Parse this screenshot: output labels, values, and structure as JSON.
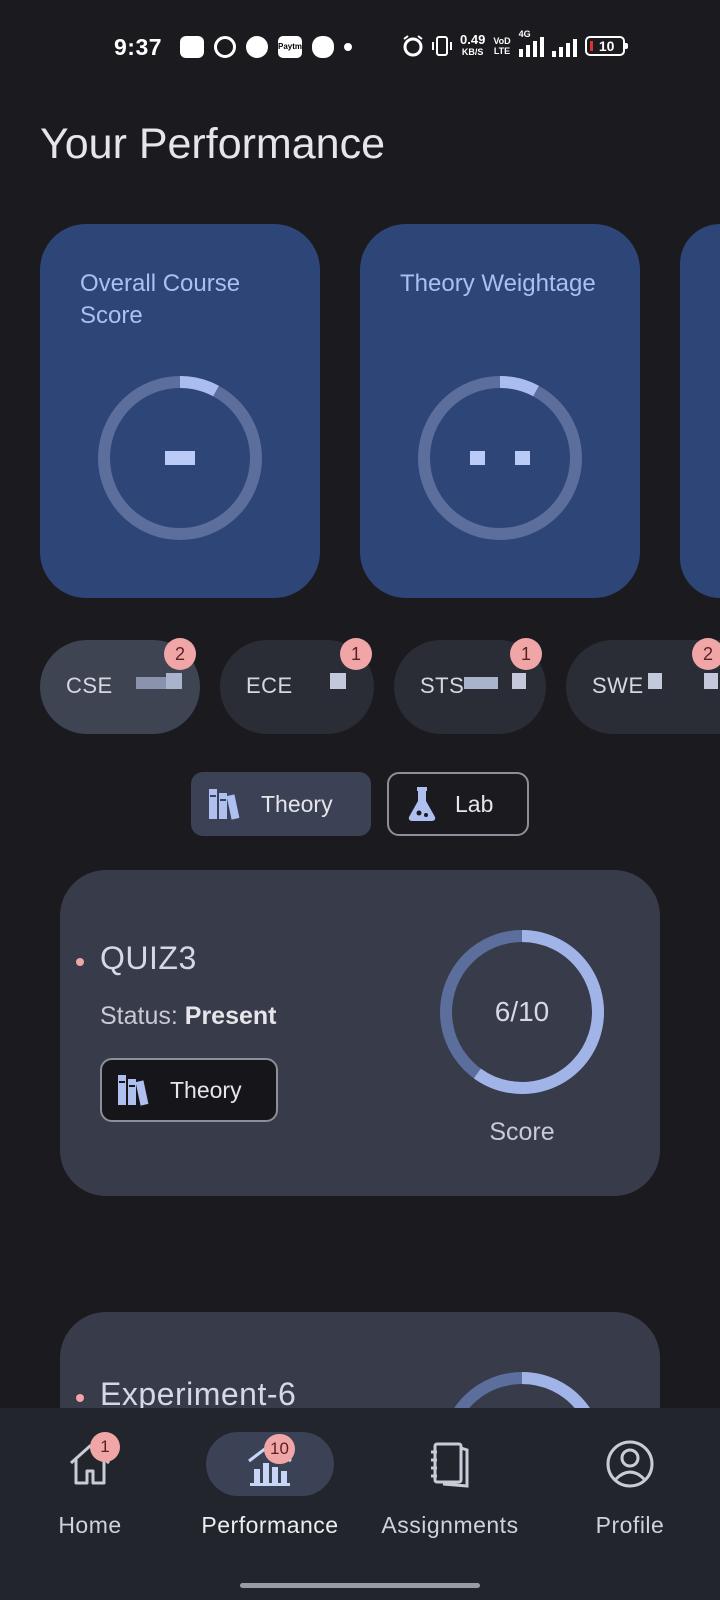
{
  "status_bar": {
    "time": "9:37",
    "paytm": "Paytm",
    "speed_value": "0.49",
    "speed_unit": "KB/S",
    "volte_top": "VoD",
    "volte_bottom": "LTE",
    "network": "4G",
    "battery": "10"
  },
  "page": {
    "title": "Your Performance"
  },
  "metrics": [
    {
      "label": "Overall Course Score",
      "value_icon": "redacted-dash",
      "ring_progress": 0.08
    },
    {
      "label": "Theory Weightage",
      "value_icon": "redacted-dots",
      "ring_progress": 0.08
    }
  ],
  "subject_chips": [
    {
      "label": "CSE",
      "badge": "2",
      "selected": true
    },
    {
      "label": "ECE",
      "badge": "1",
      "selected": false
    },
    {
      "label": "STS",
      "badge": "1",
      "selected": false
    },
    {
      "label": "SWE",
      "badge": "2",
      "selected": false
    }
  ],
  "mode_toggle": {
    "theory": "Theory",
    "lab": "Lab",
    "selected": "Theory"
  },
  "records": [
    {
      "title": "QUIZ3",
      "status_label": "Status:",
      "status_value": "Present",
      "tag": "Theory",
      "score": "6/10",
      "score_fraction": 0.6,
      "score_label": "Score"
    },
    {
      "title": "Experiment-6",
      "score_fraction": 0.6
    }
  ],
  "bottom_nav": [
    {
      "label": "Home",
      "icon": "home-icon",
      "badge": "1"
    },
    {
      "label": "Performance",
      "icon": "chart-icon",
      "badge": "10",
      "active": true
    },
    {
      "label": "Assignments",
      "icon": "notebook-icon"
    },
    {
      "label": "Profile",
      "icon": "person-icon"
    }
  ],
  "colors": {
    "background": "#1b1b1f",
    "metric_card": "#2e4577",
    "accent": "#a9bdf0",
    "badge": "#f0a6a6",
    "record_card": "#383b4a"
  }
}
